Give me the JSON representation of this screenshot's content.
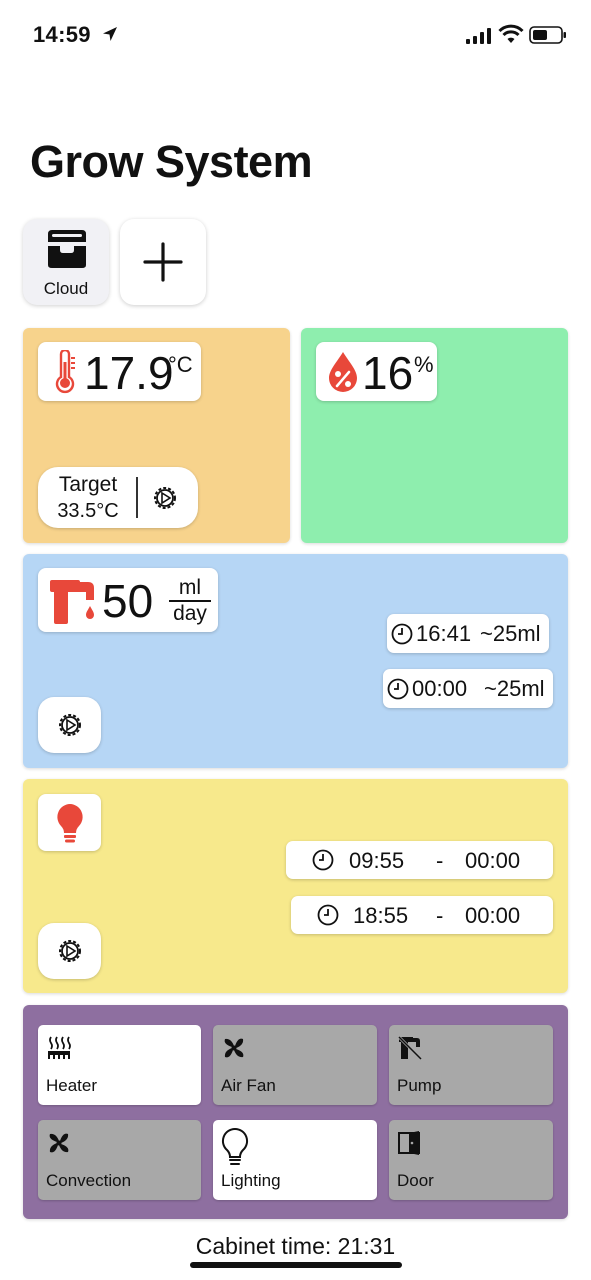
{
  "status_bar": {
    "time": "14:59",
    "icons": [
      "location-arrow-icon",
      "signal-icon",
      "wifi-icon",
      "battery-icon"
    ]
  },
  "page": {
    "title": "Grow System"
  },
  "systems": {
    "cloud_label": "Cloud",
    "add_icon": "plus-icon"
  },
  "temperature": {
    "value": "17.9",
    "unit": "°C",
    "target_label": "Target",
    "target_value": "33.5°C",
    "panel_color": "#f7d38c",
    "icon": "thermometer-icon"
  },
  "humidity": {
    "value": "16",
    "unit": "%",
    "panel_color": "#8eeeae",
    "icon": "humidity-drop-icon"
  },
  "watering": {
    "value": "50",
    "unit_top": "ml",
    "unit_bottom": "day",
    "panel_color": "#b6d6f5",
    "schedule": [
      {
        "time": "16:41",
        "amount": "~25ml"
      },
      {
        "time": "00:00",
        "amount": "~25ml"
      }
    ],
    "icon": "faucet-icon"
  },
  "lighting": {
    "panel_color": "#f7e98c",
    "icon": "lightbulb-icon",
    "schedule": [
      {
        "start": "09:55",
        "sep": "-",
        "end": "00:00"
      },
      {
        "start": "18:55",
        "sep": "-",
        "end": "00:00"
      }
    ]
  },
  "devices": {
    "panel_color": "#8e6fa0",
    "items": [
      {
        "label": "Heater",
        "state": "on",
        "icon": "heater-icon"
      },
      {
        "label": "Air Fan",
        "state": "off",
        "icon": "fan-icon"
      },
      {
        "label": "Pump",
        "state": "off",
        "icon": "pump-icon"
      },
      {
        "label": "Convection",
        "state": "off",
        "icon": "fan-icon"
      },
      {
        "label": "Lighting",
        "state": "on",
        "icon": "lightbulb-outline-icon"
      },
      {
        "label": "Door",
        "state": "off",
        "icon": "door-icon"
      }
    ]
  },
  "footer": {
    "cabinet_time": "Cabinet time: 21:31"
  },
  "colors": {
    "accent_red": "#e8483a"
  }
}
